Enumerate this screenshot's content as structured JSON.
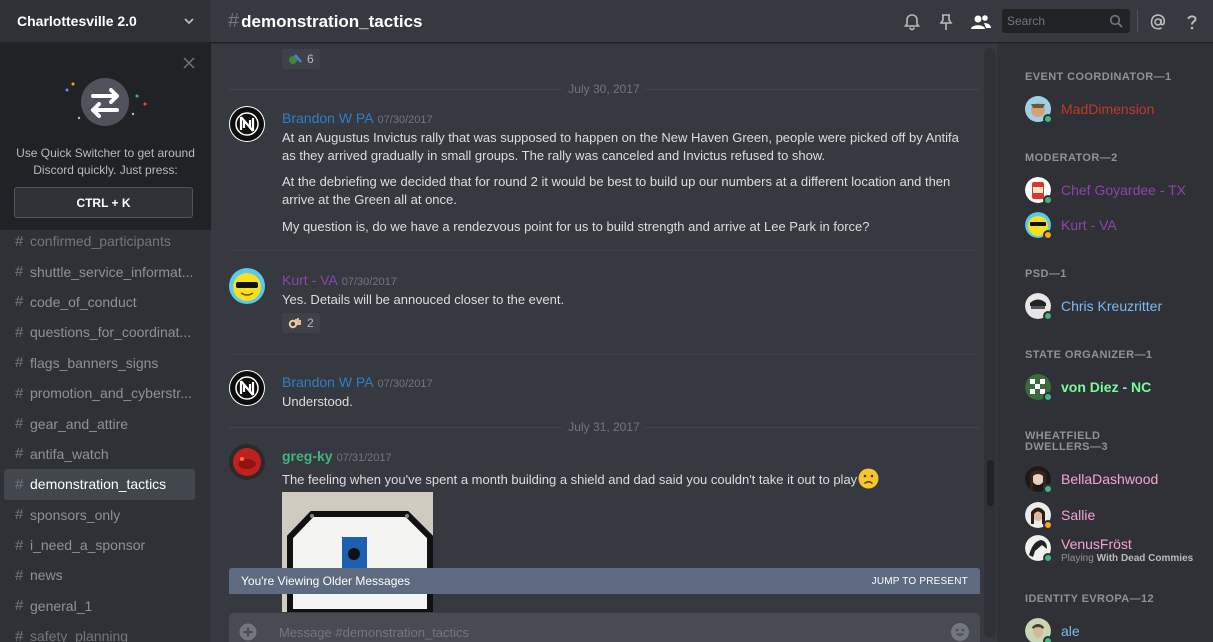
{
  "server": {
    "name": "Charlottesville 2.0"
  },
  "quick_switcher": {
    "text": "Use Quick Switcher to get around Discord quickly. Just press:",
    "shortcut": "CTRL + K"
  },
  "channels": [
    {
      "name": "confirmed_participants",
      "active": false,
      "partial": true
    },
    {
      "name": "shuttle_service_informat...",
      "active": false
    },
    {
      "name": "code_of_conduct",
      "active": false
    },
    {
      "name": "questions_for_coordinat...",
      "active": false
    },
    {
      "name": "flags_banners_signs",
      "active": false
    },
    {
      "name": "promotion_and_cyberstr...",
      "active": false
    },
    {
      "name": "gear_and_attire",
      "active": false
    },
    {
      "name": "antifa_watch",
      "active": false
    },
    {
      "name": "demonstration_tactics",
      "active": true
    },
    {
      "name": "sponsors_only",
      "active": false
    },
    {
      "name": "i_need_a_sponsor",
      "active": false
    },
    {
      "name": "news",
      "active": false
    },
    {
      "name": "general_1",
      "active": false
    },
    {
      "name": "safety_planning",
      "active": false,
      "partial": true
    }
  ],
  "channel_header": {
    "hash": "#",
    "name": "demonstration_tactics"
  },
  "search": {
    "placeholder": "Search"
  },
  "chat": {
    "top_reaction": {
      "count": "6"
    },
    "date_dividers": [
      "July 30, 2017",
      "July 31, 2017"
    ],
    "messages": [
      {
        "author": "Brandon W PA",
        "author_color": "#2f7fc8",
        "timestamp": "07/30/2017",
        "lines": [
          "At an Augustus Invictus rally that was supposed to happen on the New Haven Green, people were picked off by Antifa as they arrived gradually in small groups. The rally was canceled and Invictus refused to show.",
          "At the debriefing we decided  that for round 2 it would be best to build up our numbers at a different location  and then arrive at the Green all at once.",
          "My question is, do we have a rendezvous point for us to build strength and arrive at Lee Park in force?"
        ]
      },
      {
        "author": "Kurt - VA",
        "author_color": "#8e44ad",
        "timestamp": "07/30/2017",
        "lines": [
          "Yes. Details will be annouced closer to the event."
        ],
        "reaction": {
          "count": "2"
        }
      },
      {
        "author": "Brandon W PA",
        "author_color": "#2f7fc8",
        "timestamp": "07/30/2017",
        "lines": [
          "Understood."
        ]
      },
      {
        "author": "greg-ky",
        "author_color": "#43b581",
        "timestamp": "07/31/2017",
        "lines": [
          "The feeling when you've spent a month building a shield and dad said you couldn't take it out to play"
        ]
      }
    ],
    "older_bar": {
      "text": "You're Viewing Older Messages",
      "jump": "JUMP TO PRESENT"
    },
    "composer": {
      "placeholder": "Message #demonstration_tactics"
    }
  },
  "members": {
    "groups": [
      {
        "label": "EVENT COORDINATOR—1",
        "members": [
          {
            "name": "MadDimension",
            "color": "#c0392b",
            "status": "online"
          }
        ]
      },
      {
        "label": "MODERATOR—2",
        "members": [
          {
            "name": "Chef Goyardee - TX",
            "color": "#8e44ad",
            "status": "online"
          },
          {
            "name": "Kurt - VA",
            "color": "#8e44ad",
            "status": "idle"
          }
        ]
      },
      {
        "label": "PSD—1",
        "members": [
          {
            "name": "Chris Kreuzritter",
            "color": "#7db9f2",
            "status": "online"
          }
        ]
      },
      {
        "label": "STATE ORGANIZER—1",
        "members": [
          {
            "name": "von Diez - NC",
            "color": "#7cfc9a",
            "status": "online"
          }
        ]
      },
      {
        "label": "WHEATFIELD DWELLERS—3",
        "members": [
          {
            "name": "BellaDashwood",
            "color": "#f5a3d8",
            "status": "online"
          },
          {
            "name": "Sallie",
            "color": "#f5a3d8",
            "status": "idle"
          },
          {
            "name": "VenusFröst",
            "color": "#f5a3d8",
            "status": "online",
            "activity_prefix": "Playing",
            "activity": "With Dead Commies"
          }
        ]
      },
      {
        "label": "IDENTITY EVROPA—12",
        "members": [
          {
            "name": "ale",
            "color": "#7db9f2",
            "status": "online"
          }
        ]
      }
    ]
  },
  "colors": {
    "online": "#43b581",
    "idle": "#faa61a"
  }
}
